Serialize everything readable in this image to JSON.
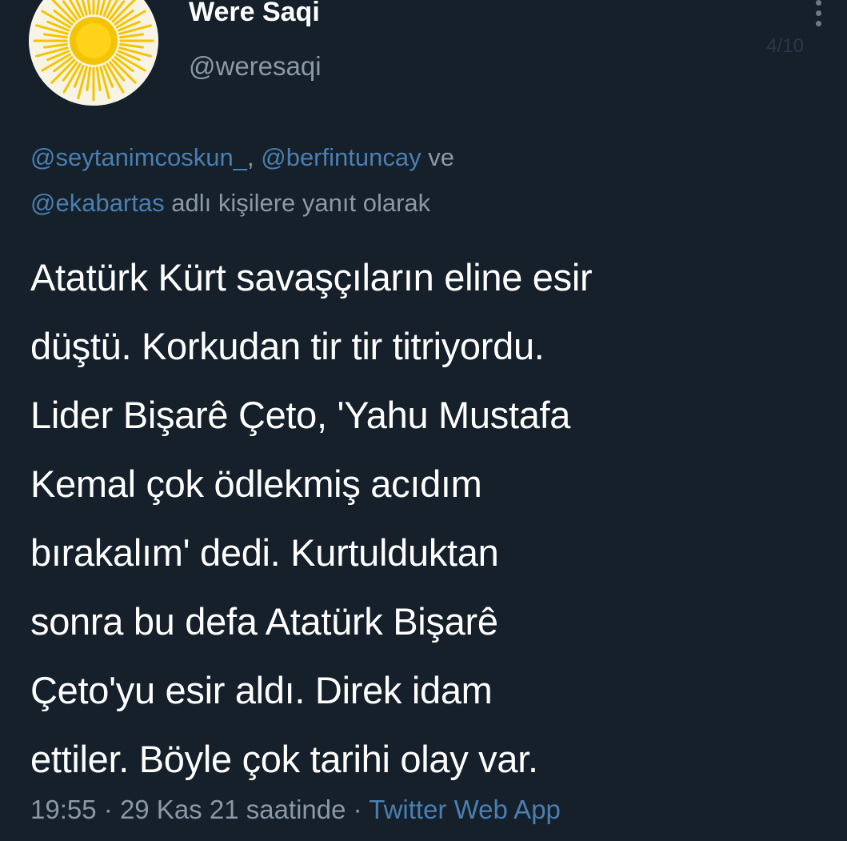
{
  "author": {
    "display_name": "Were Saqi",
    "handle": "@weresaqi",
    "avatar": "sun-avatar"
  },
  "header": {
    "page_counter": "4/10",
    "more_icon": "vertical-ellipsis-icon"
  },
  "reply_context": {
    "mentions": [
      "@seytanimcoskun_",
      "@berfintuncay",
      "@ekabartas"
    ],
    "separator": ",",
    "conjunction": "ve",
    "suffix": "adlı kişilere yanıt olarak"
  },
  "tweet": {
    "lines": [
      "Atatürk Kürt savaşçıların eline esir",
      "düştü. Korkudan tir tir titriyordu.",
      "Lider Bişarê Çeto, 'Yahu Mustafa",
      "Kemal çok ödlekmiş acıdım",
      "bırakalım' dedi. Kurtulduktan",
      "sonra bu defa Atatürk Bişarê",
      "Çeto'yu esir aldı. Direk idam",
      "ettiler. Böyle çok tarihi olay var."
    ]
  },
  "meta": {
    "time": "19:55",
    "dot": "·",
    "date": "29 Kas 21 saatinde",
    "source": "Twitter Web App"
  },
  "colors": {
    "background": "#15202b",
    "text": "#ffffff",
    "secondary_text": "#8b98a5",
    "link": "#4a7fb0",
    "avatar_sun": "#f5c400"
  }
}
